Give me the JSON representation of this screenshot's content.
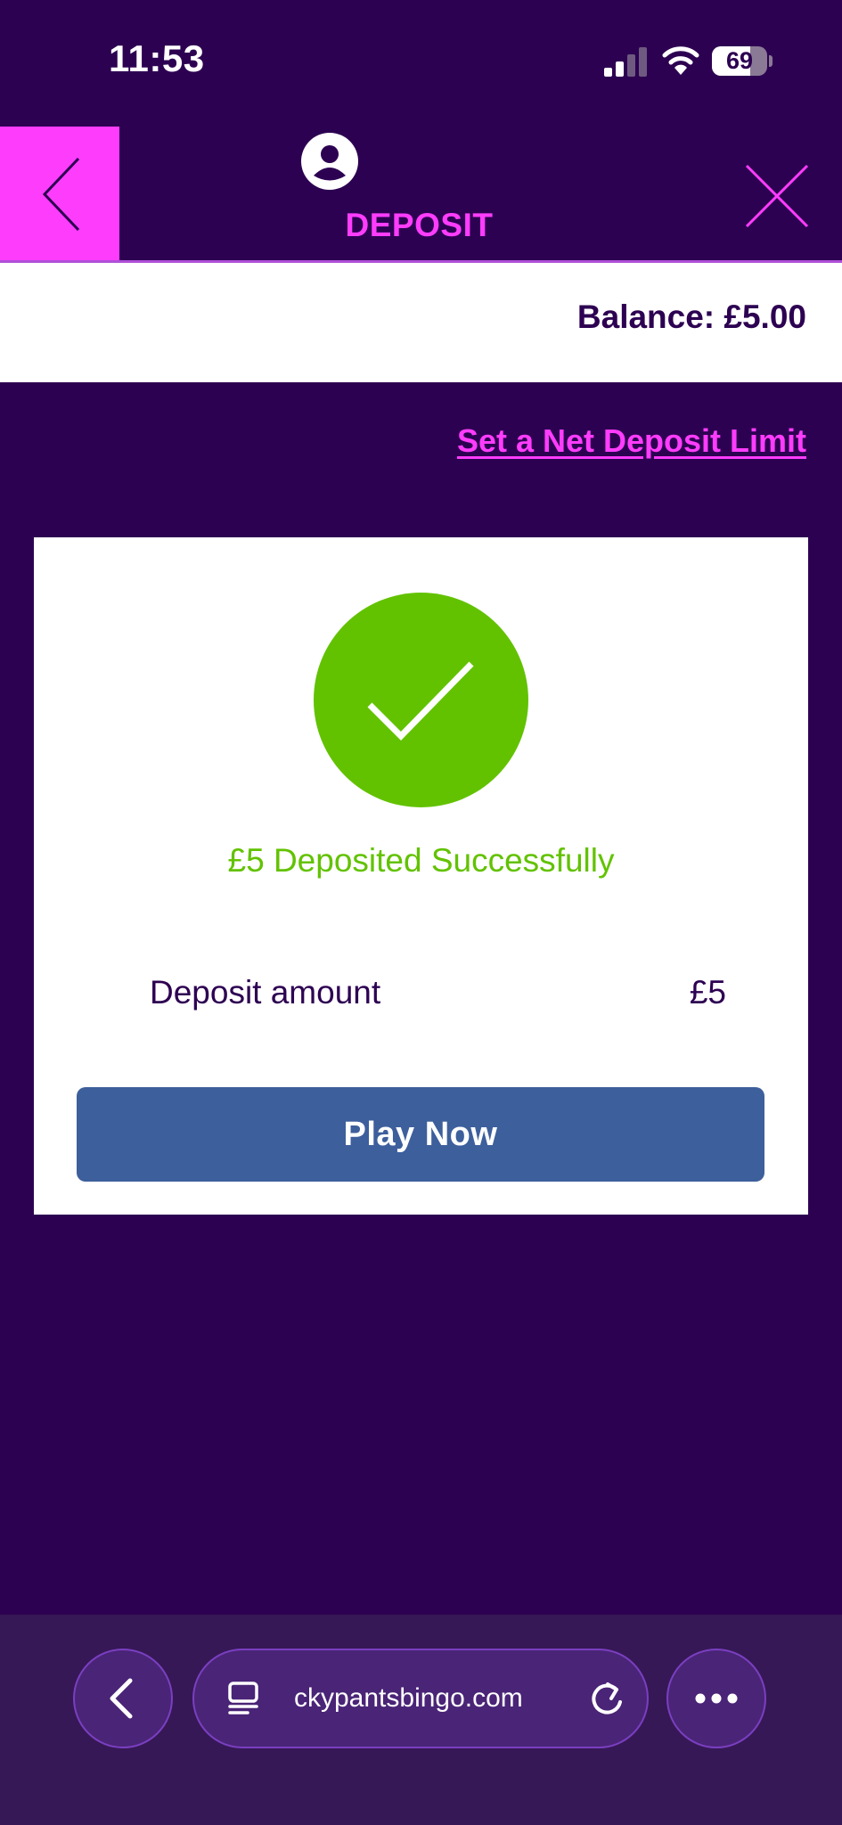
{
  "status_bar": {
    "time": "11:53",
    "battery_level": "69",
    "battery_fraction": 0.69,
    "signal_bars_active": 2,
    "signal_bars_total": 4
  },
  "header": {
    "title": "DEPOSIT",
    "back_icon": "chevron-left-icon",
    "profile_icon": "user-circle-icon",
    "close_icon": "close-icon"
  },
  "balance": {
    "text": "Balance: £5.00"
  },
  "limit_link": {
    "label": "Set a Net Deposit Limit"
  },
  "confirmation": {
    "icon": "check-icon",
    "message": "£5 Deposited Successfully",
    "detail_label": "Deposit amount",
    "detail_value": "£5",
    "button_label": "Play Now"
  },
  "browser": {
    "url": "ckypantsbingo.com",
    "back_icon": "chevron-left-icon",
    "tabs_icon": "tabs-icon",
    "reload_icon": "reload-icon",
    "more_icon": "more-icon"
  },
  "colors": {
    "background": "#2d0152",
    "accent_pink": "#fd3cfc",
    "success_green": "#62c200",
    "button_blue": "#3d5f9c",
    "browser_bar": "#361856"
  }
}
